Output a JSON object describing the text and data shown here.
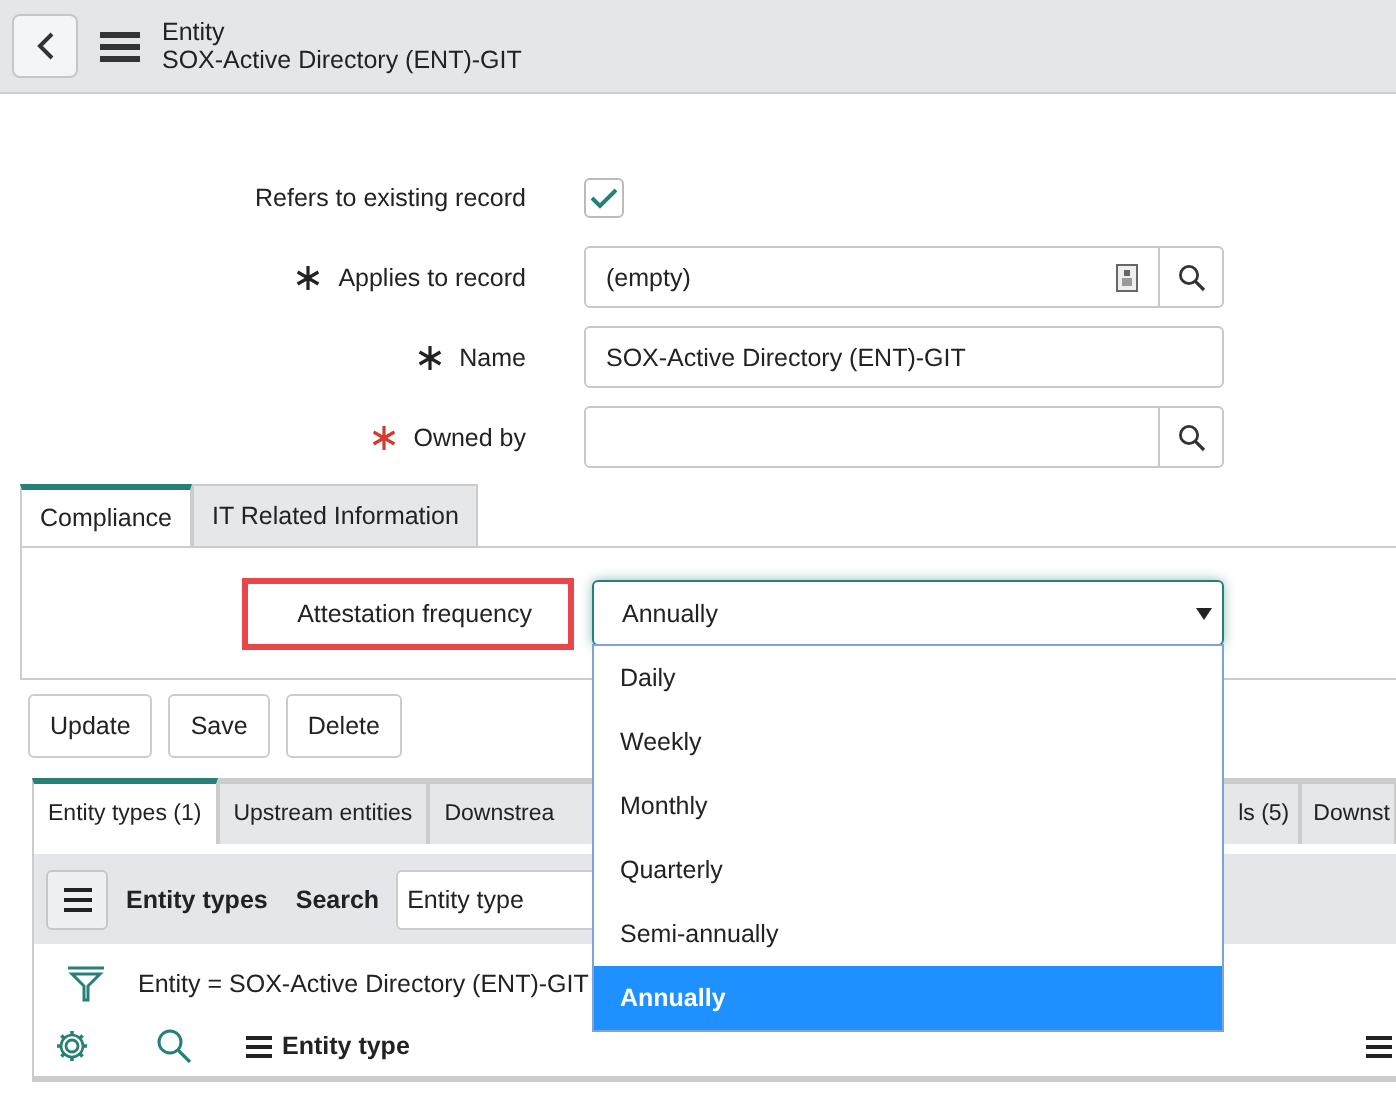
{
  "header": {
    "title": "Entity",
    "subtitle": "SOX-Active Directory (ENT)-GIT"
  },
  "form": {
    "fields": [
      {
        "label": "Refers to existing record",
        "kind": "checkbox",
        "checked": true
      },
      {
        "label": "Applies to record",
        "kind": "reference",
        "required": true,
        "missing": false,
        "value": "(empty)",
        "preview": true
      },
      {
        "label": "Name",
        "kind": "text",
        "required": true,
        "missing": false,
        "value": "SOX-Active Directory (ENT)-GIT"
      },
      {
        "label": "Owned by",
        "kind": "reference",
        "required": true,
        "missing": true,
        "preview": false
      }
    ]
  },
  "section_tabs": [
    {
      "label": "Compliance",
      "selected": true
    },
    {
      "label": "IT Related Information",
      "selected": false
    }
  ],
  "attestation": {
    "label": "Attestation frequency",
    "highlighted": true,
    "value": "Annually",
    "expanded": true,
    "options": [
      {
        "label": "Daily",
        "selected": false
      },
      {
        "label": "Weekly",
        "selected": false
      },
      {
        "label": "Monthly",
        "selected": false
      },
      {
        "label": "Quarterly",
        "selected": false
      },
      {
        "label": "Semi-annually",
        "selected": false
      },
      {
        "label": "Annually",
        "selected": true
      }
    ]
  },
  "buttons": [
    "Update",
    "Save",
    "Delete"
  ],
  "related_tabs": [
    {
      "label": "Entity types (1)",
      "selected": true
    },
    {
      "label": "Upstream entities",
      "selected": false
    },
    {
      "label": "Downstrea",
      "selected": false
    },
    {
      "label": "ls (5)",
      "selected": false
    },
    {
      "label": "Downst",
      "selected": false
    }
  ],
  "list": {
    "title": "Entity types",
    "search_label": "Search",
    "search_field": "Entity type",
    "filter": "Entity = SOX-Active Directory (ENT)-GIT",
    "columns": [
      "Entity type"
    ]
  }
}
